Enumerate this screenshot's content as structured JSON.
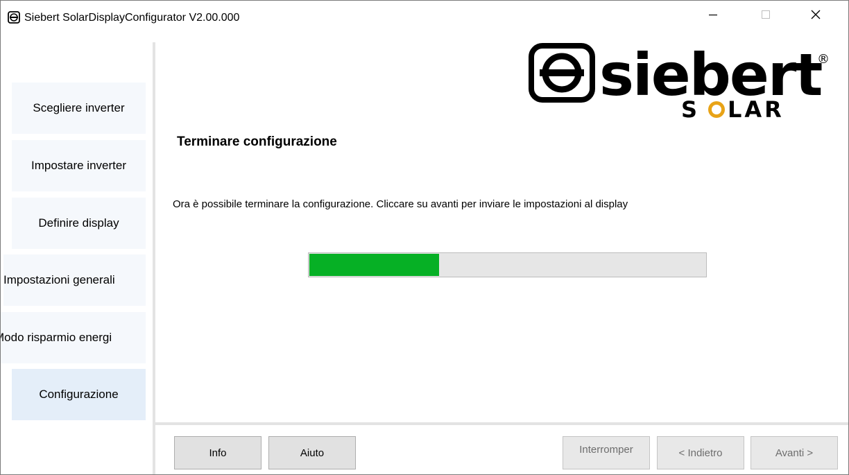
{
  "window": {
    "title": "Siebert SolarDisplayConfigurator V2.00.000"
  },
  "logo": {
    "brand": "siebert",
    "sub": "SOLAR",
    "registered": "®"
  },
  "sidebar": {
    "items": [
      {
        "label": "Scegliere inverter",
        "active": false
      },
      {
        "label": "Impostare inverter",
        "active": false
      },
      {
        "label": "Definire display",
        "active": false
      },
      {
        "label": "Impostazioni generali",
        "active": false
      },
      {
        "label": "Modo risparmio energi",
        "active": false
      },
      {
        "label": "Configurazione",
        "active": true
      }
    ]
  },
  "main": {
    "title": "Terminare configurazione",
    "description": "Ora è possibile terminare la configurazione. Cliccare su avanti per inviare le impostazioni al display",
    "progress_percent": 33
  },
  "buttons": {
    "info": "Info",
    "help": "Aiuto",
    "cancel": "Interromper",
    "back": "< Indietro",
    "next": "Avanti >"
  },
  "colors": {
    "progress_fill": "#06b025",
    "nav_active": "#e4eef9",
    "nav_inactive": "#f5f8fc"
  },
  "icons": {
    "app": "siebert-logo-icon",
    "minimize": "minimize-icon",
    "maximize": "maximize-icon",
    "close": "close-icon"
  }
}
